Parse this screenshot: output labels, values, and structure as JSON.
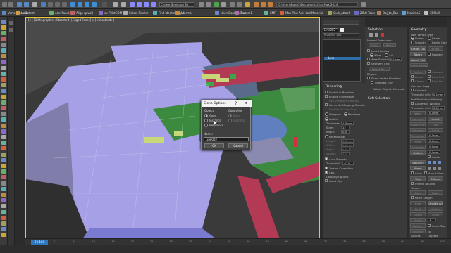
{
  "toolbar": {
    "items": [
      "Vertex Cleaner",
      "UnDetect",
      "convPanelsDiff",
      "Align (pivot)",
      "ex PillotCOM",
      "Select Similar",
      "Find Identical_Spec",
      "Vformer",
      "UsersBorders.ctx",
      "TextureE",
      "CMR",
      "Max Plus Axis Lod Material",
      "Quik_Attach",
      "ZIRO Tools",
      "Obj_to_Box",
      "MaximoS",
      "3DSkill"
    ],
    "selection_set": "Create Selection Se",
    "path": "C:\\Users\\Baku3\\Documents\\3ds Max 2024"
  },
  "viewport": {
    "label": "[+] [Orthographic] [Standard] [Edged Faces]  ▽  [<Disabled>]"
  },
  "dialog": {
    "title": "Clone Options",
    "help": "?",
    "close": "✕",
    "object_group": "Object",
    "object_options": [
      "Copy",
      "Instance",
      "Reference"
    ],
    "controller_group": "Controller",
    "controller_options": [
      "Copy",
      "Instance"
    ],
    "name_label": "Name:",
    "name_value": "Line002",
    "ok": "OK",
    "cancel": "Cancel"
  },
  "explorer": {
    "object_name": "Line002",
    "modifier_list": "Modifier List",
    "stack_item": "Line"
  },
  "rendering": {
    "title": "Rendering",
    "enable_renderer": "Enable In Renderer",
    "enable_viewport": "Enable In Viewport",
    "use_viewport": "Use Viewport Settings",
    "gen_mapping": "Generate Mapping Coords.",
    "real_world": "Real-World Map Size",
    "viewport_opt": "Viewport",
    "renderer_opt": "Renderer",
    "radial": "Radial",
    "thickness_label": "Thickness:",
    "thickness": "1.0mm",
    "sides_label": "Sides:",
    "sides": "12",
    "angle_label": "Angle:",
    "angle": "0.0",
    "rectangular": "Rectangular",
    "length_label": "Length:",
    "length": "6.0mm",
    "width_label": "Width:",
    "width": "2.0mm",
    "angle2_label": "Angle:",
    "angle2": "0.0",
    "aspect_label": "Aspect:",
    "aspect": "3.0",
    "auto_smooth": "Auto Smooth",
    "threshold_label": "Threshold:",
    "threshold": "40.0",
    "torsion": "Torsion Correction",
    "cap": "Cap",
    "capping": "Capping Options",
    "quad_cap": "Quad Cap"
  },
  "soft_selection": {
    "title": "Soft Selection"
  },
  "selection": {
    "title": "Selection",
    "named": "Named Selections:",
    "copy": "Copy",
    "paste": "Paste",
    "lock_handles": "Lock Handles",
    "alike": "Alike",
    "all": "All",
    "area_selection": "Area Selection:",
    "area_value": "0.1mm",
    "segment_end": "Segment End",
    "select_by": "Select By...",
    "display": "Display",
    "show_vertex": "Show Vertex Numbers",
    "selected_only": "Selected Only",
    "status": "Whole Object Selected"
  },
  "geometry": {
    "title": "Geometry",
    "new_vertex_type": "New Vertex Type",
    "linear": "Linear",
    "bezier": "Bezier",
    "smooth": "Smooth",
    "bezier_corner": "Bezier Corner",
    "create_line": "Create Line",
    "break": "Break",
    "attach": "Attach",
    "reorient": "Reorient",
    "attach_mult": "Attach Mult.",
    "cross_section": "Cross Section",
    "refine": "Refine",
    "connect": "Connect",
    "linear2": "Linear",
    "bind_first": "Bind first",
    "closed": "Closed",
    "bind_last": "Bind last",
    "connect_copy": "Connect Copy",
    "connect2": "Connect",
    "threshold_label": "Threshold dist:",
    "threshold": "0.1mm",
    "end_point": "End Point Auto-Welding",
    "auto_weld": "Automatic Welding",
    "threshold2_label": "Threshold dist:",
    "threshold2": "6.0mm",
    "weld": "Weld",
    "weld_val": "0.1mm",
    "connect3": "Connect",
    "insert": "Insert",
    "make_first": "Make First",
    "fuse": "Fuse",
    "reverse": "Reverse",
    "cycle": "Cycle",
    "crossinsert": "CrossInsert",
    "crossinsert_val": "0.1mm",
    "fillet": "Fillet",
    "fillet_val": "0.0mm",
    "chamfer": "Chamfer",
    "chamfer_val": "0.0mm",
    "outline": "Outline",
    "outline_val": "0.0mm",
    "center": "Center",
    "boolean": "Boolean",
    "mirror": "Mirror",
    "copy": "Copy",
    "about_pivot": "About Pivot",
    "trim": "Trim",
    "extend": "Extend",
    "infinite": "Infinite Bounds",
    "tangent": "Tangent",
    "copy2": "Copy",
    "paste2": "Paste",
    "paste_length": "Paste Length",
    "hide": "Hide",
    "unhide_all": "Unhide All",
    "bind": "Bind",
    "unbind": "Unbind",
    "delete": "Delete",
    "close": "Close",
    "divide": "Divide",
    "divide_val": "1",
    "detach": "Detach",
    "same_shp": "Same Shp",
    "reorient2": "Reorient",
    "explode": "Explode",
    "to": "to",
    "splines": "Splines",
    "objects": "Objects",
    "show_sel": "Show selected segs"
  },
  "timeline": {
    "frame": "0 / 100",
    "ticks": [
      "0",
      "5",
      "10",
      "15",
      "20",
      "25",
      "30",
      "35",
      "40",
      "45",
      "50",
      "55",
      "60",
      "65",
      "70",
      "75",
      "80",
      "85",
      "90",
      "95",
      "100"
    ]
  },
  "colors": {
    "accent_blue": "#2e78c0",
    "viewport_border": "#e9c73a",
    "pavement": "#a6a1e6",
    "grass": "#3c8a3f",
    "road": "#b23a55",
    "water": "#5f7fbf"
  }
}
